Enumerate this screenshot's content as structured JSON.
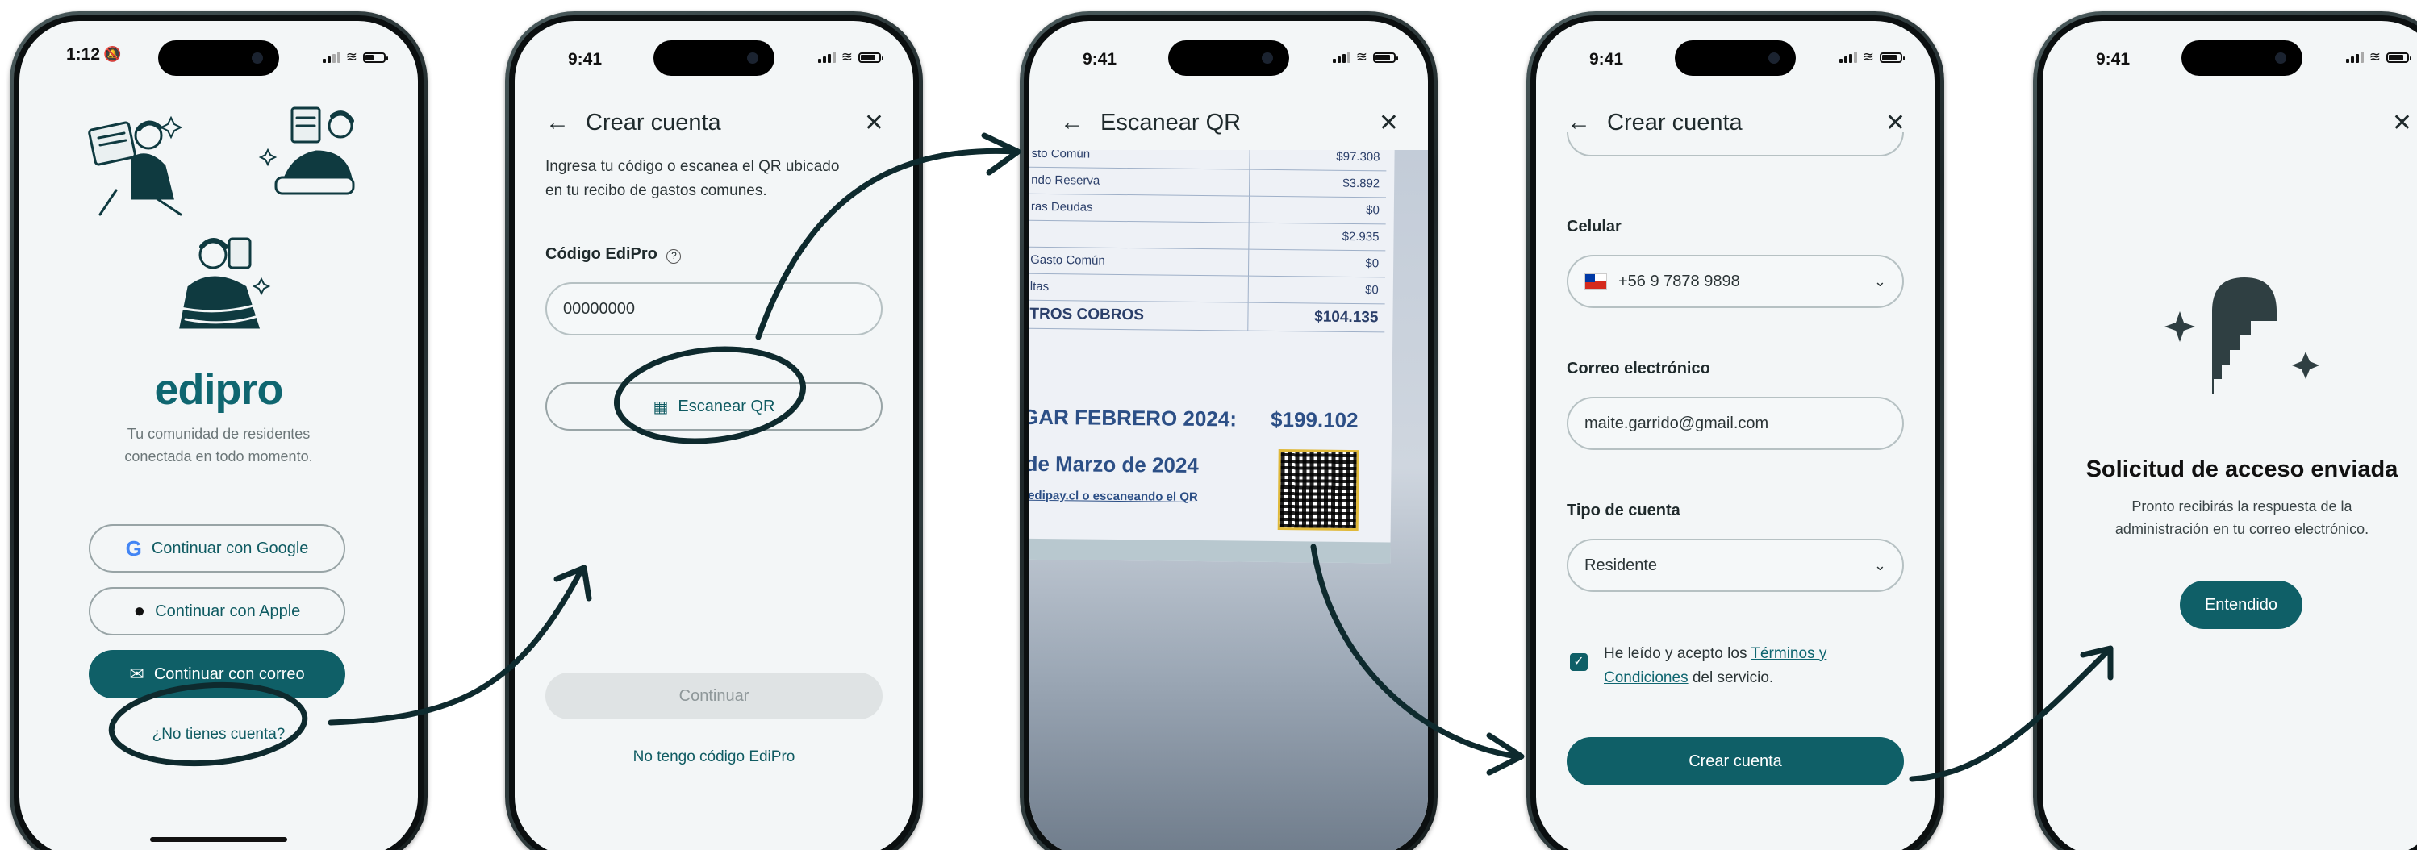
{
  "colors": {
    "brand": "#0f5f67",
    "ink": "#0f3a40",
    "screen_bg": "#f3f6f7",
    "disabled": "#dfe3e4"
  },
  "screen1": {
    "status_time": "1:12",
    "logo": "edipro",
    "tagline_line1": "Tu comunidad de residentes",
    "tagline_line2": "conectada en todo momento.",
    "google_label": "Continuar con Google",
    "apple_label": "Continuar con Apple",
    "email_label": "Continuar con correo",
    "no_account_link": "¿No tienes cuenta?",
    "icons": [
      "google-icon",
      "apple-icon",
      "mail-icon",
      "bell-muted-icon"
    ]
  },
  "screen2": {
    "status_time": "9:41",
    "title": "Crear cuenta",
    "intro_line1": "Ingresa tu código o escanea el QR ubicado",
    "intro_line2": "en tu recibo de gastos comunes.",
    "code_label": "Código EdiPro",
    "code_value": "00000000",
    "scan_label": "Escanear QR",
    "continue_label": "Continuar",
    "no_code_link": "No tengo código EdiPro"
  },
  "screen3": {
    "status_time": "9:41",
    "title": "Escanear QR",
    "receipt_rows": [
      {
        "label": "sto Común",
        "value": "$97.308"
      },
      {
        "label": "ndo Reserva",
        "value": "$3.892"
      },
      {
        "label": "ras Deudas",
        "value": "$0"
      },
      {
        "label": "",
        "value": "$2.935"
      },
      {
        "label": "Gasto Común",
        "value": "$0"
      },
      {
        "label": "ltas",
        "value": "$0"
      }
    ],
    "receipt_total_label": "TROS COBROS",
    "receipt_total_value": "$104.135",
    "pay_label": "GAR FEBRERO 2024:",
    "pay_value": "$199.102",
    "due_date": "de Marzo de 2024",
    "pay_link": "edipay.cl o escaneando el QR"
  },
  "screen4": {
    "status_time": "9:41",
    "title": "Crear cuenta",
    "phone_label": "Celular",
    "phone_value": "+56 9 7878 9898",
    "email_label": "Correo electrónico",
    "email_value": "maite.garrido@gmail.com",
    "account_type_label": "Tipo de cuenta",
    "account_type_value": "Residente",
    "terms_pre": "He leído y acepto los ",
    "terms_link_1": "Términos y",
    "terms_link_2": "Condiciones",
    "terms_post": " del servicio.",
    "submit_label": "Crear cuenta"
  },
  "screen5": {
    "status_time": "9:41",
    "heading": "Solicitud de acceso enviada",
    "body_line1": "Pronto recibirás la respuesta de la",
    "body_line2": "administración en tu correo electrónico.",
    "ok_label": "Entendido"
  }
}
